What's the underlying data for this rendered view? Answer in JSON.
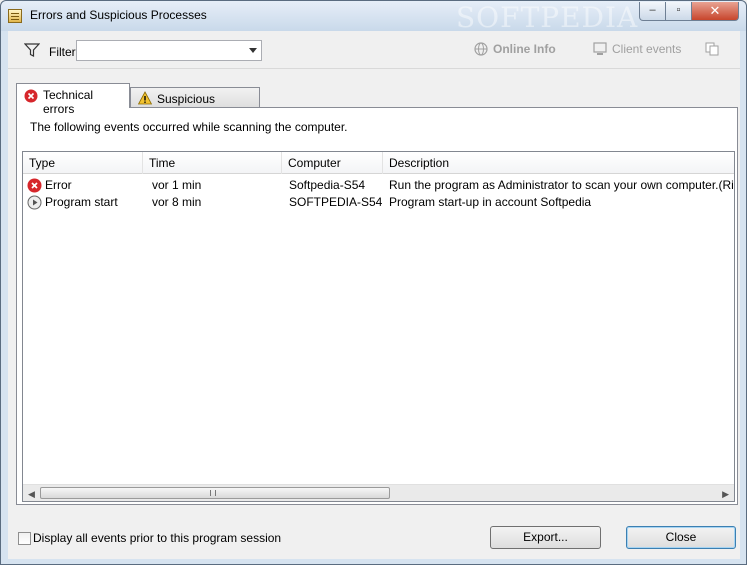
{
  "window": {
    "title": "Errors and Suspicious Processes",
    "watermark": "SOFTPEDIA",
    "min_glyph": "–",
    "max_glyph": "▫",
    "close_glyph": "✕"
  },
  "toolbar": {
    "filter_label": "Filter",
    "filter_value": "",
    "online_info": "Online Info",
    "client_events": "Client events"
  },
  "tabs": [
    {
      "label": "Technical errors",
      "icon": "error-icon",
      "active": true
    },
    {
      "label": "Suspicious processes",
      "icon": "warning-icon",
      "active": false
    }
  ],
  "panel": {
    "message": "The following events occurred while scanning the computer."
  },
  "table": {
    "columns": [
      "Type",
      "Time",
      "Computer",
      "Description"
    ],
    "rows": [
      {
        "icon": "error-icon",
        "type": "Error",
        "time": "vor  1 min",
        "computer": "Softpedia-S54",
        "description": "Run the program as Administrator to scan your own computer.(Right-click"
      },
      {
        "icon": "play-icon",
        "type": "Program start",
        "time": "vor  8 min",
        "computer": "SOFTPEDIA-S54",
        "description": "Program start-up in account Softpedia"
      }
    ]
  },
  "footer": {
    "checkbox_label": "Display all events prior to this program session",
    "checkbox_checked": false,
    "export_label": "Export...",
    "close_label": "Close"
  },
  "colors": {
    "error_red": "#d6262b",
    "warning_yellow": "#f2c230",
    "disabled_text": "#a0a0a0"
  }
}
